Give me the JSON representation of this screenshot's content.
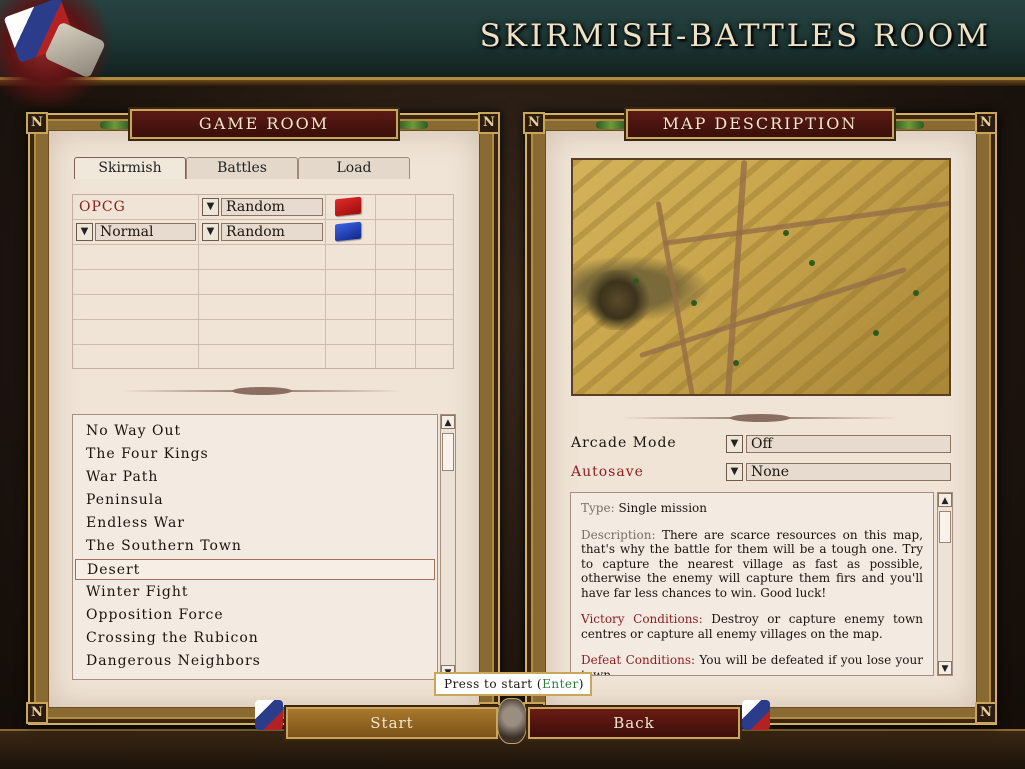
{
  "screen_title": "SKIRMISH-BATTLES ROOM",
  "corner_glyph": "N",
  "left_panel": {
    "title": "GAME ROOM",
    "tabs": [
      {
        "label": "Skirmish",
        "active": true
      },
      {
        "label": "Battles",
        "active": false
      },
      {
        "label": "Load",
        "active": false
      }
    ],
    "players": [
      {
        "name": "OPCG",
        "name_color": "#8b1d1d",
        "nation": "Random",
        "flag_color": "#c01818"
      },
      {
        "name": "Normal",
        "nation": "Random",
        "flag_color": "#1a3fb0",
        "has_name_dropdown": true
      }
    ],
    "dropdown_icon": "chevron-down-icon",
    "maps": [
      "No Way Out",
      "The Four Kings",
      "War Path",
      "Peninsula",
      "Endless War",
      "The Southern Town",
      "Desert",
      "Winter Fight",
      "Opposition Force",
      "Crossing the Rubicon",
      "Dangerous Neighbors"
    ],
    "selected_map": "Desert"
  },
  "right_panel": {
    "title": "MAP DESCRIPTION",
    "options": [
      {
        "label": "Arcade Mode",
        "value": "Off",
        "label_color": "#1b130c"
      },
      {
        "label": "Autosave",
        "value": "None",
        "label_color": "#8b1d1d"
      }
    ],
    "description": {
      "type_label": "Type:",
      "type_value": "Single mission",
      "desc_label": "Description:",
      "desc_text": "There are scarce resources on this map, that's why the battle for them will be a tough one. Try to capture the nearest village as fast as possible, otherwise the enemy will capture them firs and you'll have far less chances to win. Good luck!",
      "victory_label": "Victory Conditions:",
      "victory_text": "Destroy or capture enemy town centres or capture all enemy villages on the map.",
      "defeat_label": "Defeat Conditions:",
      "defeat_text": "You will be defeated if you lose your town"
    }
  },
  "footer": {
    "tooltip_prefix": "Press to start (",
    "tooltip_key": "Enter",
    "tooltip_suffix": ")",
    "start_label": "Start",
    "back_label": "Back"
  },
  "colors": {
    "accent_gold": "#c9a659",
    "banner_red": "#5c1a14",
    "paper": "#efe4d6",
    "topbar_teal": "#274442"
  }
}
